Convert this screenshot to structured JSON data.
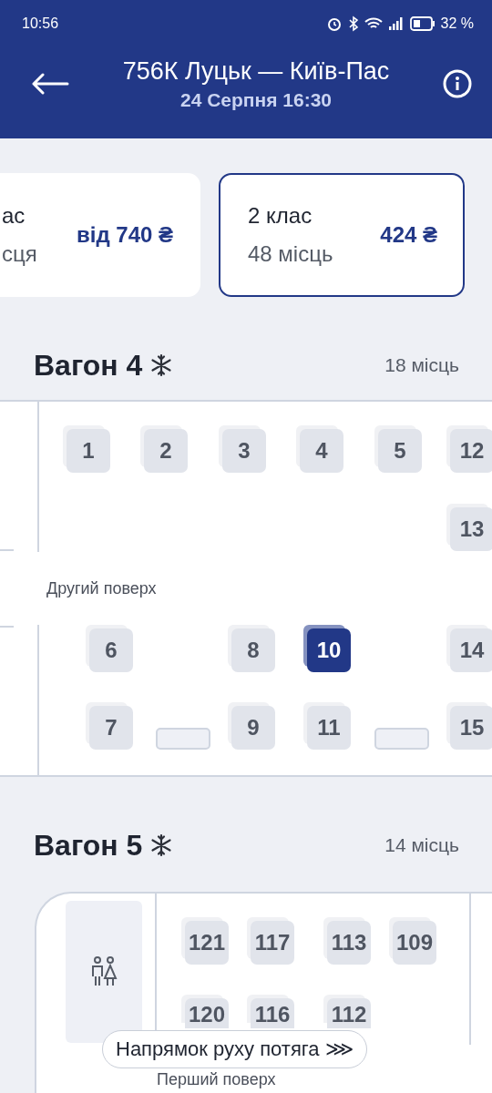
{
  "status_bar": {
    "time": "10:56",
    "battery": "32 %"
  },
  "header": {
    "title": "756К Луцьк — Київ-Пас",
    "subtitle": "24 Серпня 16:30"
  },
  "classes": [
    {
      "name": "ас",
      "seats": "сця",
      "price": "від 740 ₴",
      "selected": false
    },
    {
      "name": "2 клас",
      "seats": "48 місць",
      "price": "424 ₴",
      "selected": true
    }
  ],
  "wagons": [
    {
      "title": "Вагон 4",
      "seats_count": "18 місць",
      "floor_label": "Другий поверх",
      "seats": [
        {
          "number": "1",
          "selected": false
        },
        {
          "number": "2",
          "selected": false
        },
        {
          "number": "3",
          "selected": false
        },
        {
          "number": "4",
          "selected": false
        },
        {
          "number": "5",
          "selected": false
        },
        {
          "number": "12",
          "selected": false
        },
        {
          "number": "13",
          "selected": false
        },
        {
          "number": "6",
          "selected": false
        },
        {
          "number": "8",
          "selected": false
        },
        {
          "number": "10",
          "selected": true
        },
        {
          "number": "14",
          "selected": false
        },
        {
          "number": "7",
          "selected": false
        },
        {
          "number": "9",
          "selected": false
        },
        {
          "number": "11",
          "selected": false
        },
        {
          "number": "15",
          "selected": false
        }
      ]
    },
    {
      "title": "Вагон 5",
      "seats_count": "14 місць",
      "floor_label": "Перший поверх",
      "seats": [
        {
          "number": "121",
          "selected": false
        },
        {
          "number": "117",
          "selected": false
        },
        {
          "number": "113",
          "selected": false
        },
        {
          "number": "109",
          "selected": false
        },
        {
          "number": "120",
          "selected": false
        },
        {
          "number": "116",
          "selected": false
        },
        {
          "number": "112",
          "selected": false
        }
      ]
    }
  ],
  "direction_button": {
    "label": "Напрямок руху потяга ⋙"
  }
}
